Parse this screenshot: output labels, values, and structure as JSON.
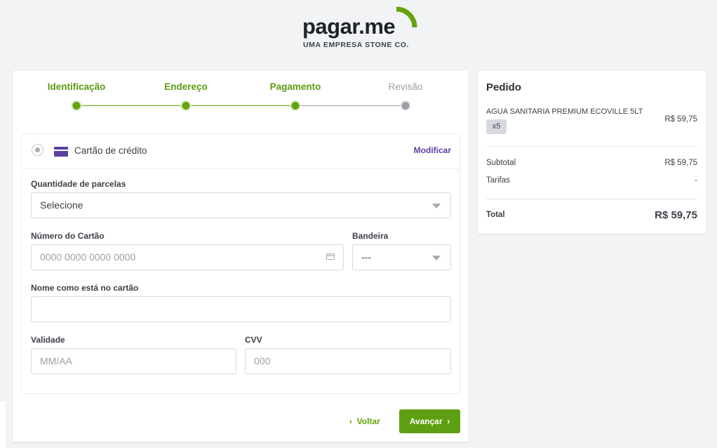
{
  "brand": {
    "logo_text": "pagar.me",
    "tagline": "UMA EMPRESA STONE CO.",
    "accent_color": "#65a30d"
  },
  "stepper": {
    "steps": [
      {
        "label": "Identificação",
        "status": "done"
      },
      {
        "label": "Endereço",
        "status": "done"
      },
      {
        "label": "Pagamento",
        "status": "current"
      },
      {
        "label": "Revisão",
        "status": "pending"
      }
    ]
  },
  "payment": {
    "method_label": "Cartão de crédito",
    "method_icon": "credit-card-icon",
    "modify_label": "Modificar",
    "installments": {
      "label": "Quantidade de parcelas",
      "value": "Selecione"
    },
    "card_number": {
      "label": "Número do Cartão",
      "placeholder": "0000 0000 0000 0000"
    },
    "brand_select": {
      "label": "Bandeira",
      "value": "---"
    },
    "holder_name": {
      "label": "Nome como está no cartão",
      "placeholder": ""
    },
    "expiry": {
      "label": "Validade",
      "placeholder": "MM/AA"
    },
    "cvv": {
      "label": "CVV",
      "placeholder": "000"
    }
  },
  "actions": {
    "back_label": "Voltar",
    "next_label": "Avançar"
  },
  "order": {
    "title": "Pedido",
    "item_name": "AGUA SANITARIA PREMIUM ECOVILLE 5LT",
    "item_qty": "x5",
    "item_price": "R$ 59,75",
    "subtotal_label": "Subtotal",
    "subtotal_value": "R$ 59,75",
    "fees_label": "Tarifas",
    "fees_value": "-",
    "total_label": "Total",
    "total_value": "R$ 59,75"
  }
}
